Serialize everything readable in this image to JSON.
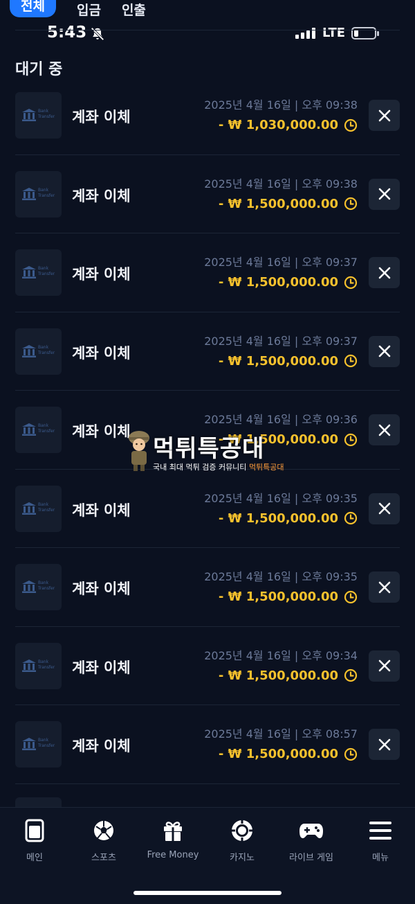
{
  "tabs": [
    {
      "label": "전체",
      "active": true
    },
    {
      "label": "입금",
      "active": false
    },
    {
      "label": "인출",
      "active": false
    }
  ],
  "status_bar": {
    "time": "5:43",
    "network": "LTE"
  },
  "section_title": "대기 중",
  "transactions": [
    {
      "method": "계좌 이체",
      "icon_text": "Bank Transfer",
      "date": "2025년 4월 16일 | 오후 09:38",
      "amount": "- ₩ 1,030,000.00"
    },
    {
      "method": "계좌 이체",
      "icon_text": "Bank Transfer",
      "date": "2025년 4월 16일 | 오후 09:38",
      "amount": "- ₩ 1,500,000.00"
    },
    {
      "method": "계좌 이체",
      "icon_text": "Bank Transfer",
      "date": "2025년 4월 16일 | 오후 09:37",
      "amount": "- ₩ 1,500,000.00"
    },
    {
      "method": "계좌 이체",
      "icon_text": "Bank Transfer",
      "date": "2025년 4월 16일 | 오후 09:37",
      "amount": "- ₩ 1,500,000.00"
    },
    {
      "method": "계좌 이체",
      "icon_text": "Bank Transfer",
      "date": "2025년 4월 16일 | 오후 09:36",
      "amount": "- ₩ 1,500,000.00"
    },
    {
      "method": "계좌 이체",
      "icon_text": "Bank Transfer",
      "date": "2025년 4월 16일 | 오후 09:35",
      "amount": "- ₩ 1,500,000.00"
    },
    {
      "method": "계좌 이체",
      "icon_text": "Bank Transfer",
      "date": "2025년 4월 16일 | 오후 09:35",
      "amount": "- ₩ 1,500,000.00"
    },
    {
      "method": "계좌 이체",
      "icon_text": "Bank Transfer",
      "date": "2025년 4월 16일 | 오후 09:34",
      "amount": "- ₩ 1,500,000.00"
    },
    {
      "method": "계좌 이체",
      "icon_text": "Bank Transfer",
      "date": "2025년 4월 16일 | 오후 08:57",
      "amount": "- ₩ 1,500,000.00"
    }
  ],
  "watermark": {
    "title": "먹튀특공대",
    "subtitle": "국내 최대 먹튀 검증 커뮤니티",
    "subtitle_brand": "먹튀특공대"
  },
  "bottom_nav": [
    {
      "label": "메인",
      "icon": "home-icon"
    },
    {
      "label": "스포츠",
      "icon": "soccer-ball-icon"
    },
    {
      "label": "Free Money",
      "icon": "gift-icon"
    },
    {
      "label": "카지노",
      "icon": "casino-chip-icon"
    },
    {
      "label": "라이브 게임",
      "icon": "gamepad-icon"
    },
    {
      "label": "메뉴",
      "icon": "hamburger-menu-icon"
    }
  ],
  "colors": {
    "background": "#0b1120",
    "accent": "#1f78ff",
    "amount": "#f6c12d",
    "date": "#6c7a99"
  }
}
